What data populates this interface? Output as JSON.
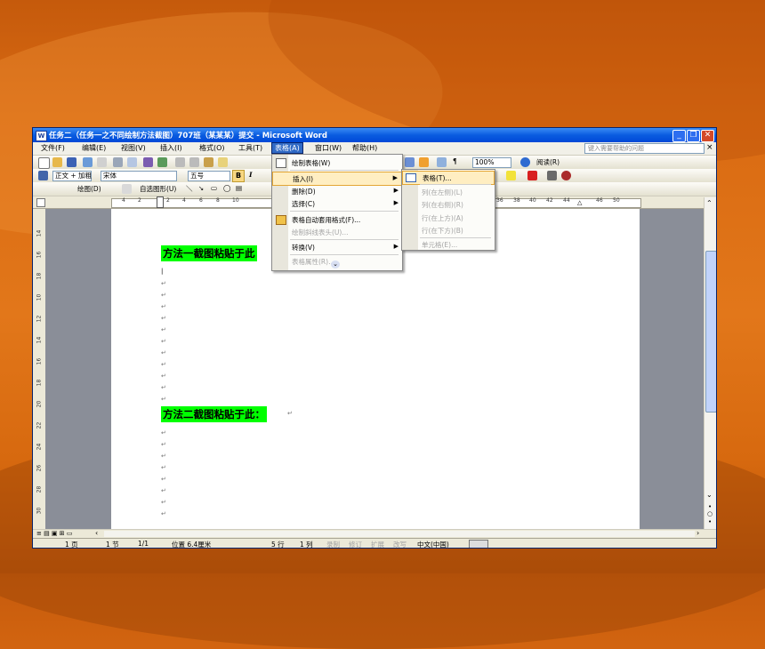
{
  "window": {
    "title": "任务二（任务一之不同绘制方法截图）707班（某某某）提交 - Microsoft Word",
    "app_icon": "W"
  },
  "menubar": {
    "items": [
      "文件(F)",
      "编辑(E)",
      "视图(V)",
      "插入(I)",
      "格式(O)",
      "工具(T)",
      "表格(A)",
      "窗口(W)",
      "帮助(H)"
    ],
    "help_placeholder": "键入需要帮助的问题",
    "close": "× "
  },
  "toolbar1": {
    "zoom": "100%",
    "read": "阅读(R)"
  },
  "toolbar2": {
    "style": "正文 + 加粗",
    "font": "宋体",
    "size": "五号",
    "bold": "B",
    "italic": "I"
  },
  "toolbar3": {
    "draw": "绘图(D)",
    "autoshape": "自选图形(U)"
  },
  "ruler": {
    "ticks": [
      "4",
      "2",
      "2",
      "4",
      "6",
      "8",
      "10",
      "36",
      "38",
      "40",
      "42",
      "44",
      "46",
      "50"
    ]
  },
  "vruler": {
    "ticks": [
      "14",
      "16",
      "18",
      "10",
      "12",
      "14",
      "16",
      "18",
      "20",
      "22",
      "24",
      "26",
      "28",
      "30"
    ]
  },
  "document": {
    "heading1": "方法一截图粘贴于此",
    "heading2": "方法二截图粘贴于此：",
    "para_mark": "↵"
  },
  "table_menu": {
    "items": [
      {
        "label": "绘制表格(W)",
        "enabled": true
      },
      {
        "label": "插入(I)",
        "enabled": true,
        "submenu": true,
        "active": true
      },
      {
        "label": "删除(D)",
        "enabled": true,
        "submenu": true
      },
      {
        "label": "选择(C)",
        "enabled": true,
        "submenu": true
      },
      {
        "label": "表格自动套用格式(F)...",
        "enabled": true
      },
      {
        "label": "绘制斜线表头(U)...",
        "enabled": false
      },
      {
        "label": "转换(V)",
        "enabled": true,
        "submenu": true
      },
      {
        "label": "表格属性(R)...",
        "enabled": false
      }
    ],
    "more": "⌄"
  },
  "insert_submenu": {
    "items": [
      {
        "label": "表格(T)...",
        "enabled": true,
        "active": true
      },
      {
        "label": "列(在左侧)(L)",
        "enabled": false
      },
      {
        "label": "列(在右侧)(R)",
        "enabled": false
      },
      {
        "label": "行(在上方)(A)",
        "enabled": false
      },
      {
        "label": "行(在下方)(B)",
        "enabled": false
      },
      {
        "label": "单元格(E)...",
        "enabled": false
      }
    ]
  },
  "statusbar": {
    "page": "1 页",
    "section": "1 节",
    "pages": "1/1",
    "position": "位置 6.4厘米",
    "line": "5 行",
    "col": "1 列",
    "rec": "录制",
    "trk": "修订",
    "ext": "扩展",
    "ovr": "改写",
    "lang": "中文(中国)"
  },
  "colors": {
    "highlight": "#00ff00",
    "title_bar": "#0a5ce0",
    "menu_active": "#316ac5",
    "menu_hover": "#ffeec2"
  }
}
